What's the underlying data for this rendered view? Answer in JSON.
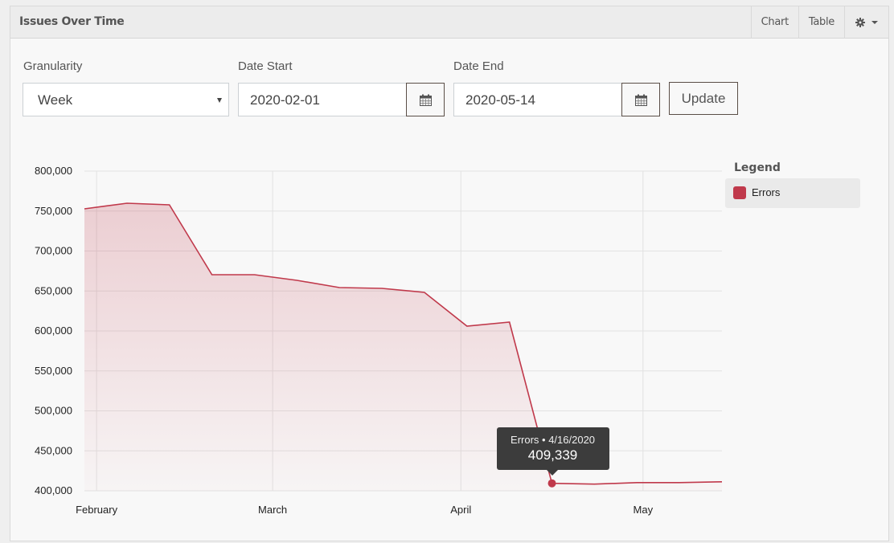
{
  "panel": {
    "title": "Issues Over Time",
    "tabs": [
      {
        "label": "Chart"
      },
      {
        "label": "Table"
      }
    ],
    "settings_icon": "gear-icon"
  },
  "filters": {
    "granularity": {
      "label": "Granularity",
      "value": "Week"
    },
    "date_start": {
      "label": "Date Start",
      "value": "2020-02-01",
      "icon": "calendar-icon"
    },
    "date_end": {
      "label": "Date End",
      "value": "2020-05-14",
      "icon": "calendar-icon"
    },
    "update_label": "Update"
  },
  "legend": {
    "title": "Legend",
    "items": [
      {
        "label": "Errors",
        "color": "#c0394b"
      }
    ]
  },
  "tooltip": {
    "header": "Errors • 4/16/2020",
    "value": "409,339",
    "point_index": 11
  },
  "chart_data": {
    "type": "area",
    "title": "Issues Over Time",
    "xlabel": "",
    "ylabel": "",
    "ylim": [
      400000,
      800000
    ],
    "yticks": [
      400000,
      450000,
      500000,
      550000,
      600000,
      650000,
      700000,
      750000,
      800000
    ],
    "ytick_labels": [
      "400,000",
      "450,000",
      "500,000",
      "550,000",
      "600,000",
      "650,000",
      "700,000",
      "750,000",
      "800,000"
    ],
    "xlim": [
      "2020-01-30",
      "2020-05-14"
    ],
    "xticks": [
      {
        "date": "2020-02-01",
        "label": "February"
      },
      {
        "date": "2020-03-01",
        "label": "March"
      },
      {
        "date": "2020-04-01",
        "label": "April"
      },
      {
        "date": "2020-05-01",
        "label": "May"
      }
    ],
    "grid": true,
    "legend_position": "right",
    "series": [
      {
        "name": "Errors",
        "color": "#c0394b",
        "x": [
          "2020-01-30",
          "2020-02-06",
          "2020-02-13",
          "2020-02-20",
          "2020-02-27",
          "2020-03-05",
          "2020-03-12",
          "2020-03-19",
          "2020-03-26",
          "2020-04-02",
          "2020-04-09",
          "2020-04-16",
          "2020-04-23",
          "2020-04-30",
          "2020-05-07",
          "2020-05-14"
        ],
        "values": [
          752800,
          759800,
          757800,
          670400,
          670400,
          663300,
          654300,
          653300,
          648200,
          606000,
          611100,
          409339,
          408300,
          410300,
          410300,
          411300
        ]
      }
    ]
  }
}
